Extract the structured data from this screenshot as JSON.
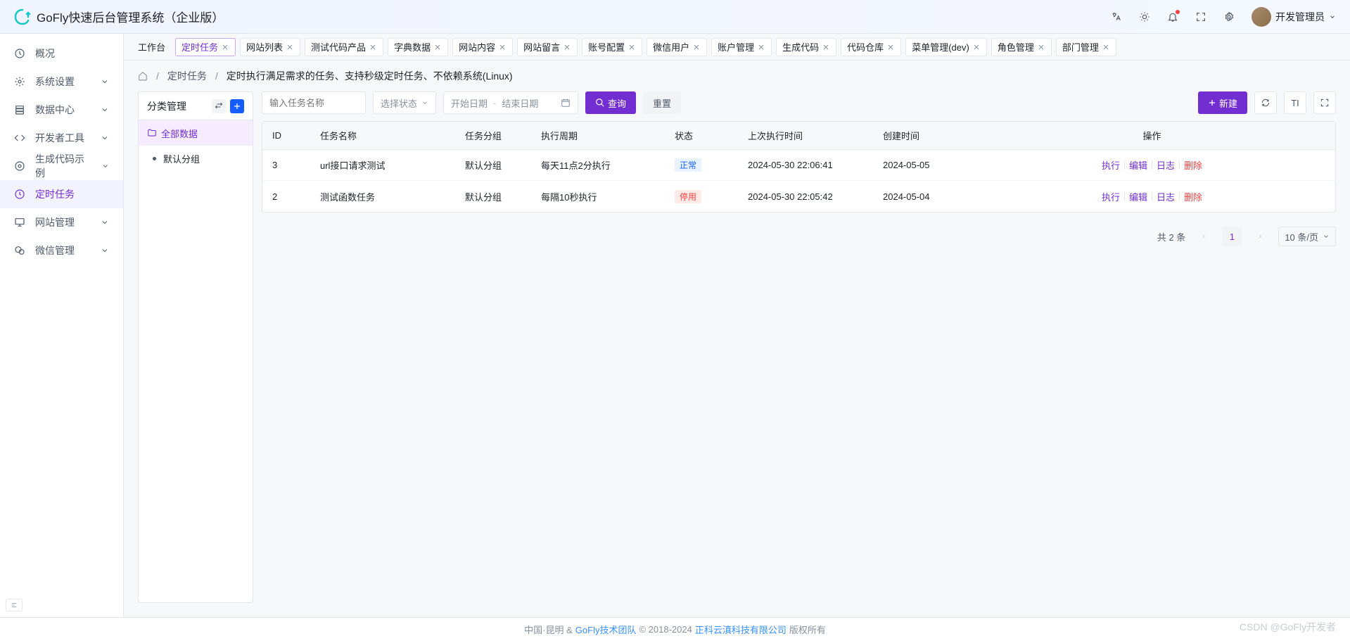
{
  "header": {
    "title": "GoFly快速后台管理系统（企业版）",
    "user_name": "开发管理员"
  },
  "sidebar": {
    "items": [
      {
        "label": "概况",
        "icon": "dashboard"
      },
      {
        "label": "系统设置",
        "icon": "settings",
        "expandable": true
      },
      {
        "label": "数据中心",
        "icon": "database",
        "expandable": true
      },
      {
        "label": "开发者工具",
        "icon": "code",
        "expandable": true
      },
      {
        "label": "生成代码示例",
        "icon": "app",
        "expandable": true
      },
      {
        "label": "定时任务",
        "icon": "clock",
        "active": true
      },
      {
        "label": "网站管理",
        "icon": "monitor",
        "expandable": true
      },
      {
        "label": "微信管理",
        "icon": "wechat",
        "expandable": true
      }
    ]
  },
  "tabs": [
    {
      "label": "工作台",
      "home": true
    },
    {
      "label": "定时任务",
      "active": true
    },
    {
      "label": "网站列表"
    },
    {
      "label": "测试代码产品"
    },
    {
      "label": "字典数据"
    },
    {
      "label": "网站内容"
    },
    {
      "label": "网站留言"
    },
    {
      "label": "账号配置"
    },
    {
      "label": "微信用户"
    },
    {
      "label": "账户管理"
    },
    {
      "label": "生成代码"
    },
    {
      "label": "代码仓库"
    },
    {
      "label": "菜单管理(dev)"
    },
    {
      "label": "角色管理"
    },
    {
      "label": "部门管理"
    }
  ],
  "breadcrumb": {
    "link": "定时任务",
    "current": "定时执行满足需求的任务、支持秒级定时任务、不依赖系统(Linux)"
  },
  "side_panel": {
    "title": "分类管理",
    "categories": [
      {
        "label": "全部数据",
        "active": true,
        "icon": "folder"
      },
      {
        "label": "默认分组"
      }
    ]
  },
  "toolbar": {
    "search_placeholder": "输入任务名称",
    "status_placeholder": "选择状态",
    "start_date_placeholder": "开始日期",
    "end_date_placeholder": "结束日期",
    "search_btn": "查询",
    "reset_btn": "重置",
    "new_btn": "新建"
  },
  "table": {
    "columns": [
      "ID",
      "任务名称",
      "任务分组",
      "执行周期",
      "状态",
      "上次执行时间",
      "创建时间",
      "操作"
    ],
    "rows": [
      {
        "id": "3",
        "name": "url接口请求测试",
        "group": "默认分组",
        "cycle": "每天11点2分执行",
        "status": "正常",
        "status_type": "normal",
        "last_exec": "2024-05-30 22:06:41",
        "created": "2024-05-05"
      },
      {
        "id": "2",
        "name": "测试函数任务",
        "group": "默认分组",
        "cycle": "每隔10秒执行",
        "status": "停用",
        "status_type": "stopped",
        "last_exec": "2024-05-30 22:05:42",
        "created": "2024-05-04"
      }
    ],
    "actions": {
      "exec": "执行",
      "edit": "编辑",
      "log": "日志",
      "delete": "删除"
    }
  },
  "pagination": {
    "total_label": "共 2 条",
    "current": "1",
    "page_size": "10 条/页"
  },
  "footer": {
    "loc": "中国·昆明 &",
    "team": "GoFly技术团队",
    "copy": "© 2018-2024",
    "company": "正科云滇科技有限公司",
    "rights": "版权所有"
  },
  "watermark": "CSDN @GoFly开发者"
}
